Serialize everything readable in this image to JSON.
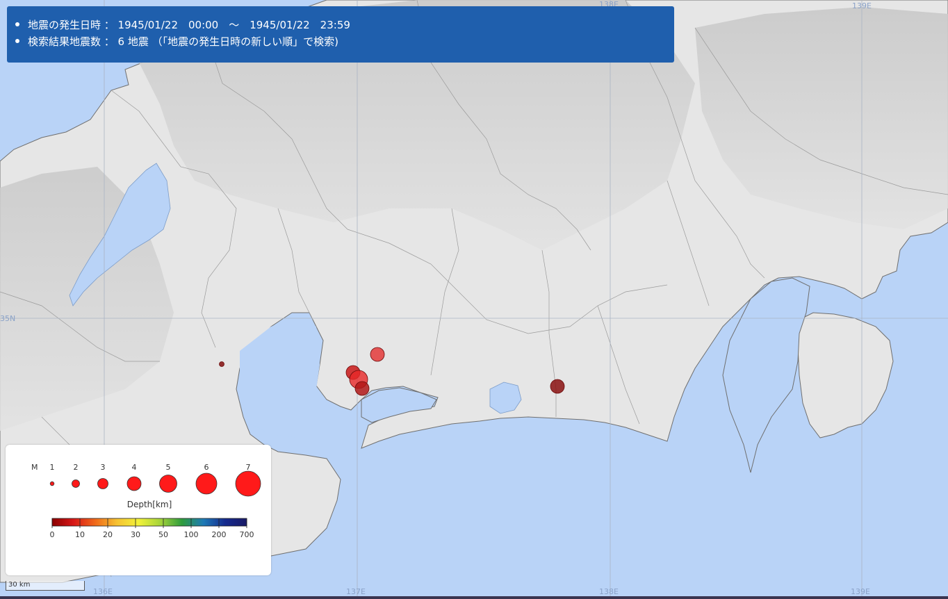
{
  "info": {
    "line1": "地震の発生日時 ： 1945/01/22　00:00　～　1945/01/22　23:59",
    "line2": "検索結果地震数 ： 6 地震 （「地震の発生日時の新しい順」で検索)"
  },
  "map": {
    "grid_labels": {
      "lon": [
        "136E",
        "137E",
        "138E",
        "139E"
      ],
      "lat": [
        "35N"
      ]
    },
    "scale_label": "30 km"
  },
  "earthquakes": [
    {
      "color": "#e33030",
      "opacity": 0.8,
      "size": "medium"
    },
    {
      "color": "#c81818",
      "opacity": 0.85,
      "size": "medium"
    },
    {
      "color": "#e82828",
      "opacity": 0.8,
      "size": "large"
    },
    {
      "color": "#b01818",
      "opacity": 0.85,
      "size": "medium"
    },
    {
      "color": "#8a1010",
      "opacity": 0.85,
      "size": "medium"
    },
    {
      "color": "#8a1a1a",
      "opacity": 0.9,
      "size": "small"
    }
  ],
  "legend": {
    "magnitude_label": "M",
    "magnitudes": [
      "1",
      "2",
      "3",
      "4",
      "5",
      "6",
      "7"
    ],
    "depth_title": "Depth[km]",
    "depth_ticks": [
      "0",
      "10",
      "20",
      "30",
      "50",
      "100",
      "200",
      "700"
    ],
    "depth_colors": [
      "#8b0000",
      "#d81818",
      "#f06a1a",
      "#f6c232",
      "#f2f23a",
      "#a6d43a",
      "#2e9c3c",
      "#1e7ab6",
      "#152a8e",
      "#1a1a66"
    ]
  }
}
